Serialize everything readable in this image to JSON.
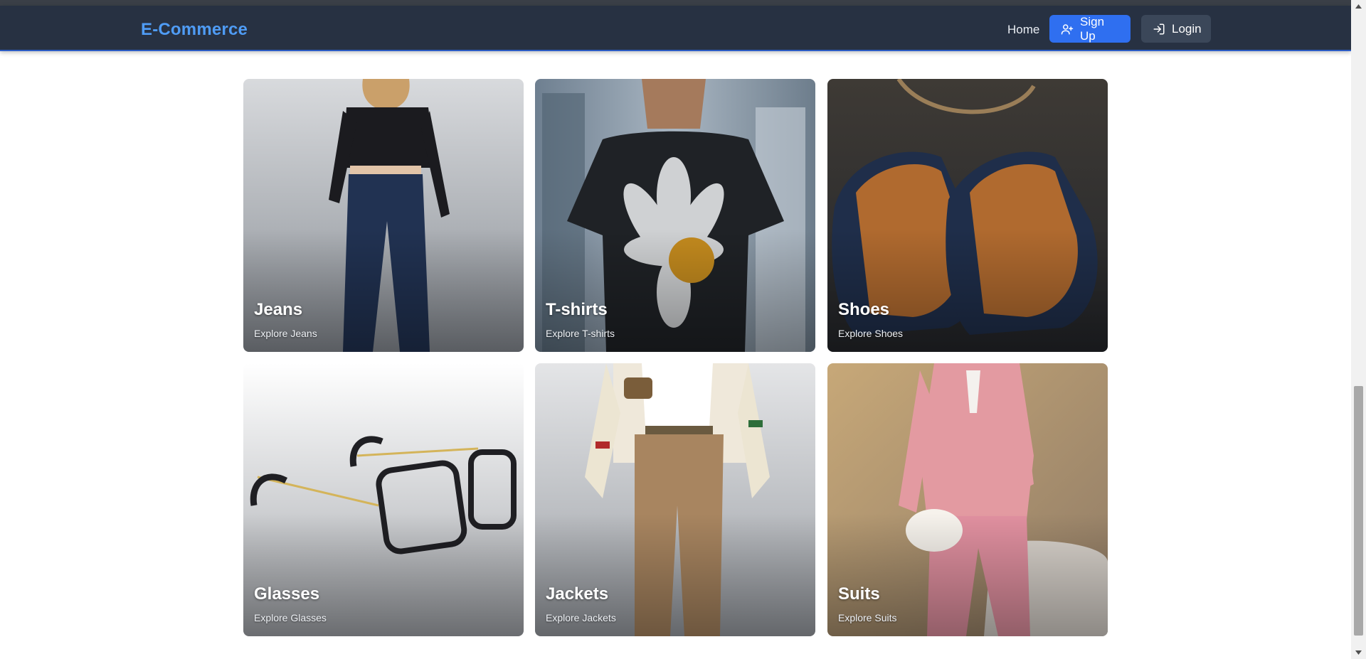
{
  "navbar": {
    "brand": "E-Commerce",
    "home_label": "Home",
    "signup_label": "Sign Up",
    "login_label": "Login"
  },
  "categories": [
    {
      "title": "Jeans",
      "subtitle": "Explore Jeans"
    },
    {
      "title": "T-shirts",
      "subtitle": "Explore T-shirts"
    },
    {
      "title": "Shoes",
      "subtitle": "Explore Shoes"
    },
    {
      "title": "Glasses",
      "subtitle": "Explore Glasses"
    },
    {
      "title": "Jackets",
      "subtitle": "Explore Jackets"
    },
    {
      "title": "Suits",
      "subtitle": "Explore Suits"
    }
  ],
  "colors": {
    "navbar_bg": "#273142",
    "brand": "#4f9cf5",
    "signup_bg": "#2f6ff0",
    "login_bg": "#3b4759"
  },
  "icons": {
    "signup": "user-plus-icon",
    "login": "log-in-icon"
  }
}
